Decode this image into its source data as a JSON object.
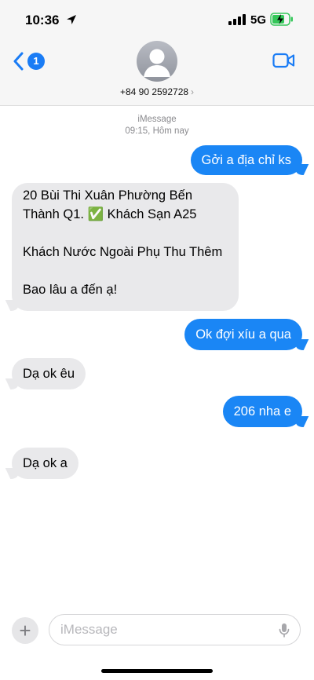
{
  "status_bar": {
    "time": "10:36",
    "network": "5G"
  },
  "nav": {
    "back_badge": "1",
    "contact": "+84 90 2592728",
    "contact_chevron": "›",
    "icons": [
      "chevron-left-icon",
      "person-icon",
      "video-camera-icon"
    ]
  },
  "thread": {
    "service": "iMessage",
    "timestamp": "09:15, Hôm nay",
    "messages": [
      {
        "from": "me",
        "text": "Gởi a địa chỉ ks"
      },
      {
        "from": "them",
        "lines": [
          "20 Bùi Thi Xuân Phường Bến",
          "Thành Q1. ✅ Khách Sạn A25",
          "",
          "Khách Nước Ngoài Phụ Thu Thêm",
          "",
          "Bao lâu a đến ạ!"
        ]
      },
      {
        "from": "me",
        "text": "Ok đợi xíu a qua"
      },
      {
        "from": "them",
        "text": "Dạ ok êu"
      },
      {
        "from": "me",
        "text": "206 nha e"
      },
      {
        "from": "them",
        "text": "Dạ ok a"
      }
    ]
  },
  "composer": {
    "plus": "+",
    "placeholder": "iMessage",
    "value": ""
  },
  "colors": {
    "outgoing_bubble": "#1a86f5",
    "incoming_bubble": "#e9e9eb",
    "accent": "#1a7cf5",
    "battery_charge": "#34c759"
  }
}
